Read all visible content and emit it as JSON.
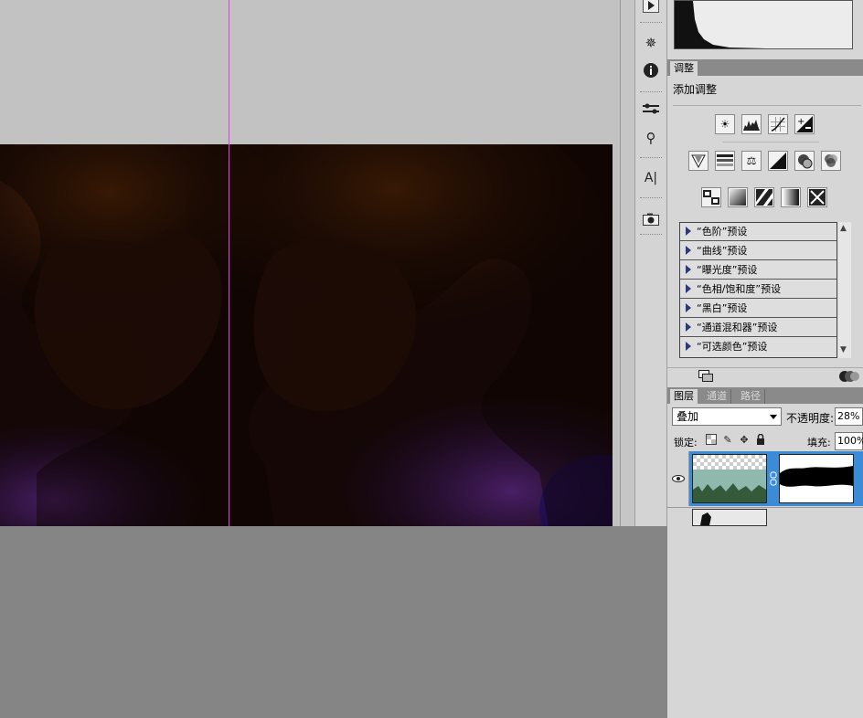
{
  "adjustments_panel": {
    "tab_label": "调整",
    "title": "添加调整",
    "presets": [
      "“色阶”预设",
      "“曲线”预设",
      "“曝光度”预设",
      "“色相/饱和度”预设",
      "“黑白”预设",
      "“通道混和器”预设",
      "“可选颜色”预设"
    ]
  },
  "layers_panel": {
    "tabs": [
      "图层",
      "通道",
      "路径"
    ],
    "blend_mode": "叠加",
    "opacity_label": "不透明度:",
    "opacity_value": "28%",
    "lock_label": "锁定:",
    "fill_label": "填充:",
    "fill_value": "100%"
  },
  "colors": {
    "selection_blue": "#3c8bd6",
    "guide_magenta": "#e040e0",
    "panel_gray": "#d6d6d6"
  },
  "icons": {
    "dock": [
      "play-icon",
      "navigator-icon",
      "info-icon",
      "brush-preset-icon",
      "clone-source-icon",
      "character-icon",
      "snapshot-icon"
    ],
    "adjustment_row1": [
      "brightness-icon",
      "levels-icon",
      "curves-icon",
      "exposure-icon"
    ],
    "adjustment_row2": [
      "vibrance-icon",
      "hue-saturation-icon",
      "color-balance-icon",
      "black-white-icon",
      "photo-filter-icon",
      "channel-mixer-icon"
    ],
    "adjustment_row3": [
      "invert-icon",
      "posterize-icon",
      "threshold-icon",
      "gradient-map-icon",
      "selective-color-icon"
    ]
  }
}
